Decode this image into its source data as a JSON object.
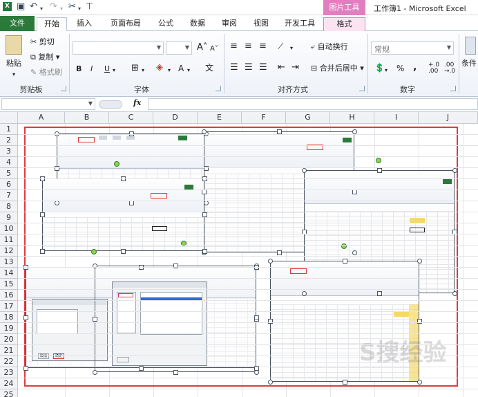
{
  "window": {
    "title": "工作簿1 - Microsoft Excel",
    "context_tab_group": "图片工具"
  },
  "tabs": [
    "文件",
    "开始",
    "插入",
    "页面布局",
    "公式",
    "数据",
    "审阅",
    "视图",
    "开发工具",
    "格式"
  ],
  "active_tab": "开始",
  "ribbon": {
    "clipboard": {
      "paste": "粘贴",
      "cut": "剪切",
      "copy": "复制",
      "format_painter": "格式刷",
      "label": "剪贴板"
    },
    "font": {
      "bold": "B",
      "italic": "I",
      "underline": "U",
      "label": "字体"
    },
    "alignment": {
      "wrap_text": "自动换行",
      "merge_center": "合并后居中",
      "label": "对齐方式"
    },
    "number": {
      "format": "常规",
      "percent": "%",
      "comma": ",",
      "label": "数字"
    },
    "styles": {
      "conditional": "条件"
    }
  },
  "formula_bar": {
    "fx": "fx",
    "name_box": "",
    "formula": ""
  },
  "sheet": {
    "columns": [
      "A",
      "B",
      "C",
      "D",
      "E",
      "F",
      "G",
      "H",
      "I",
      "J"
    ],
    "rows": [
      "1",
      "2",
      "3",
      "4",
      "5",
      "6",
      "7",
      "8",
      "9",
      "10",
      "11",
      "12",
      "13",
      "14",
      "15",
      "16",
      "17",
      "18",
      "19",
      "20",
      "21",
      "22",
      "23",
      "24",
      "25"
    ]
  },
  "pasted_screenshots": {
    "tab_labels": [
      "开发工具",
      "文件",
      "开始"
    ],
    "dialog_button": "确定",
    "cancel_button": "取消"
  },
  "colors": {
    "file_tab": "#2b7a3a",
    "context_tab": "#e27ec0",
    "red_frame": "#e0393e",
    "handle_green": "#8bd25a"
  }
}
